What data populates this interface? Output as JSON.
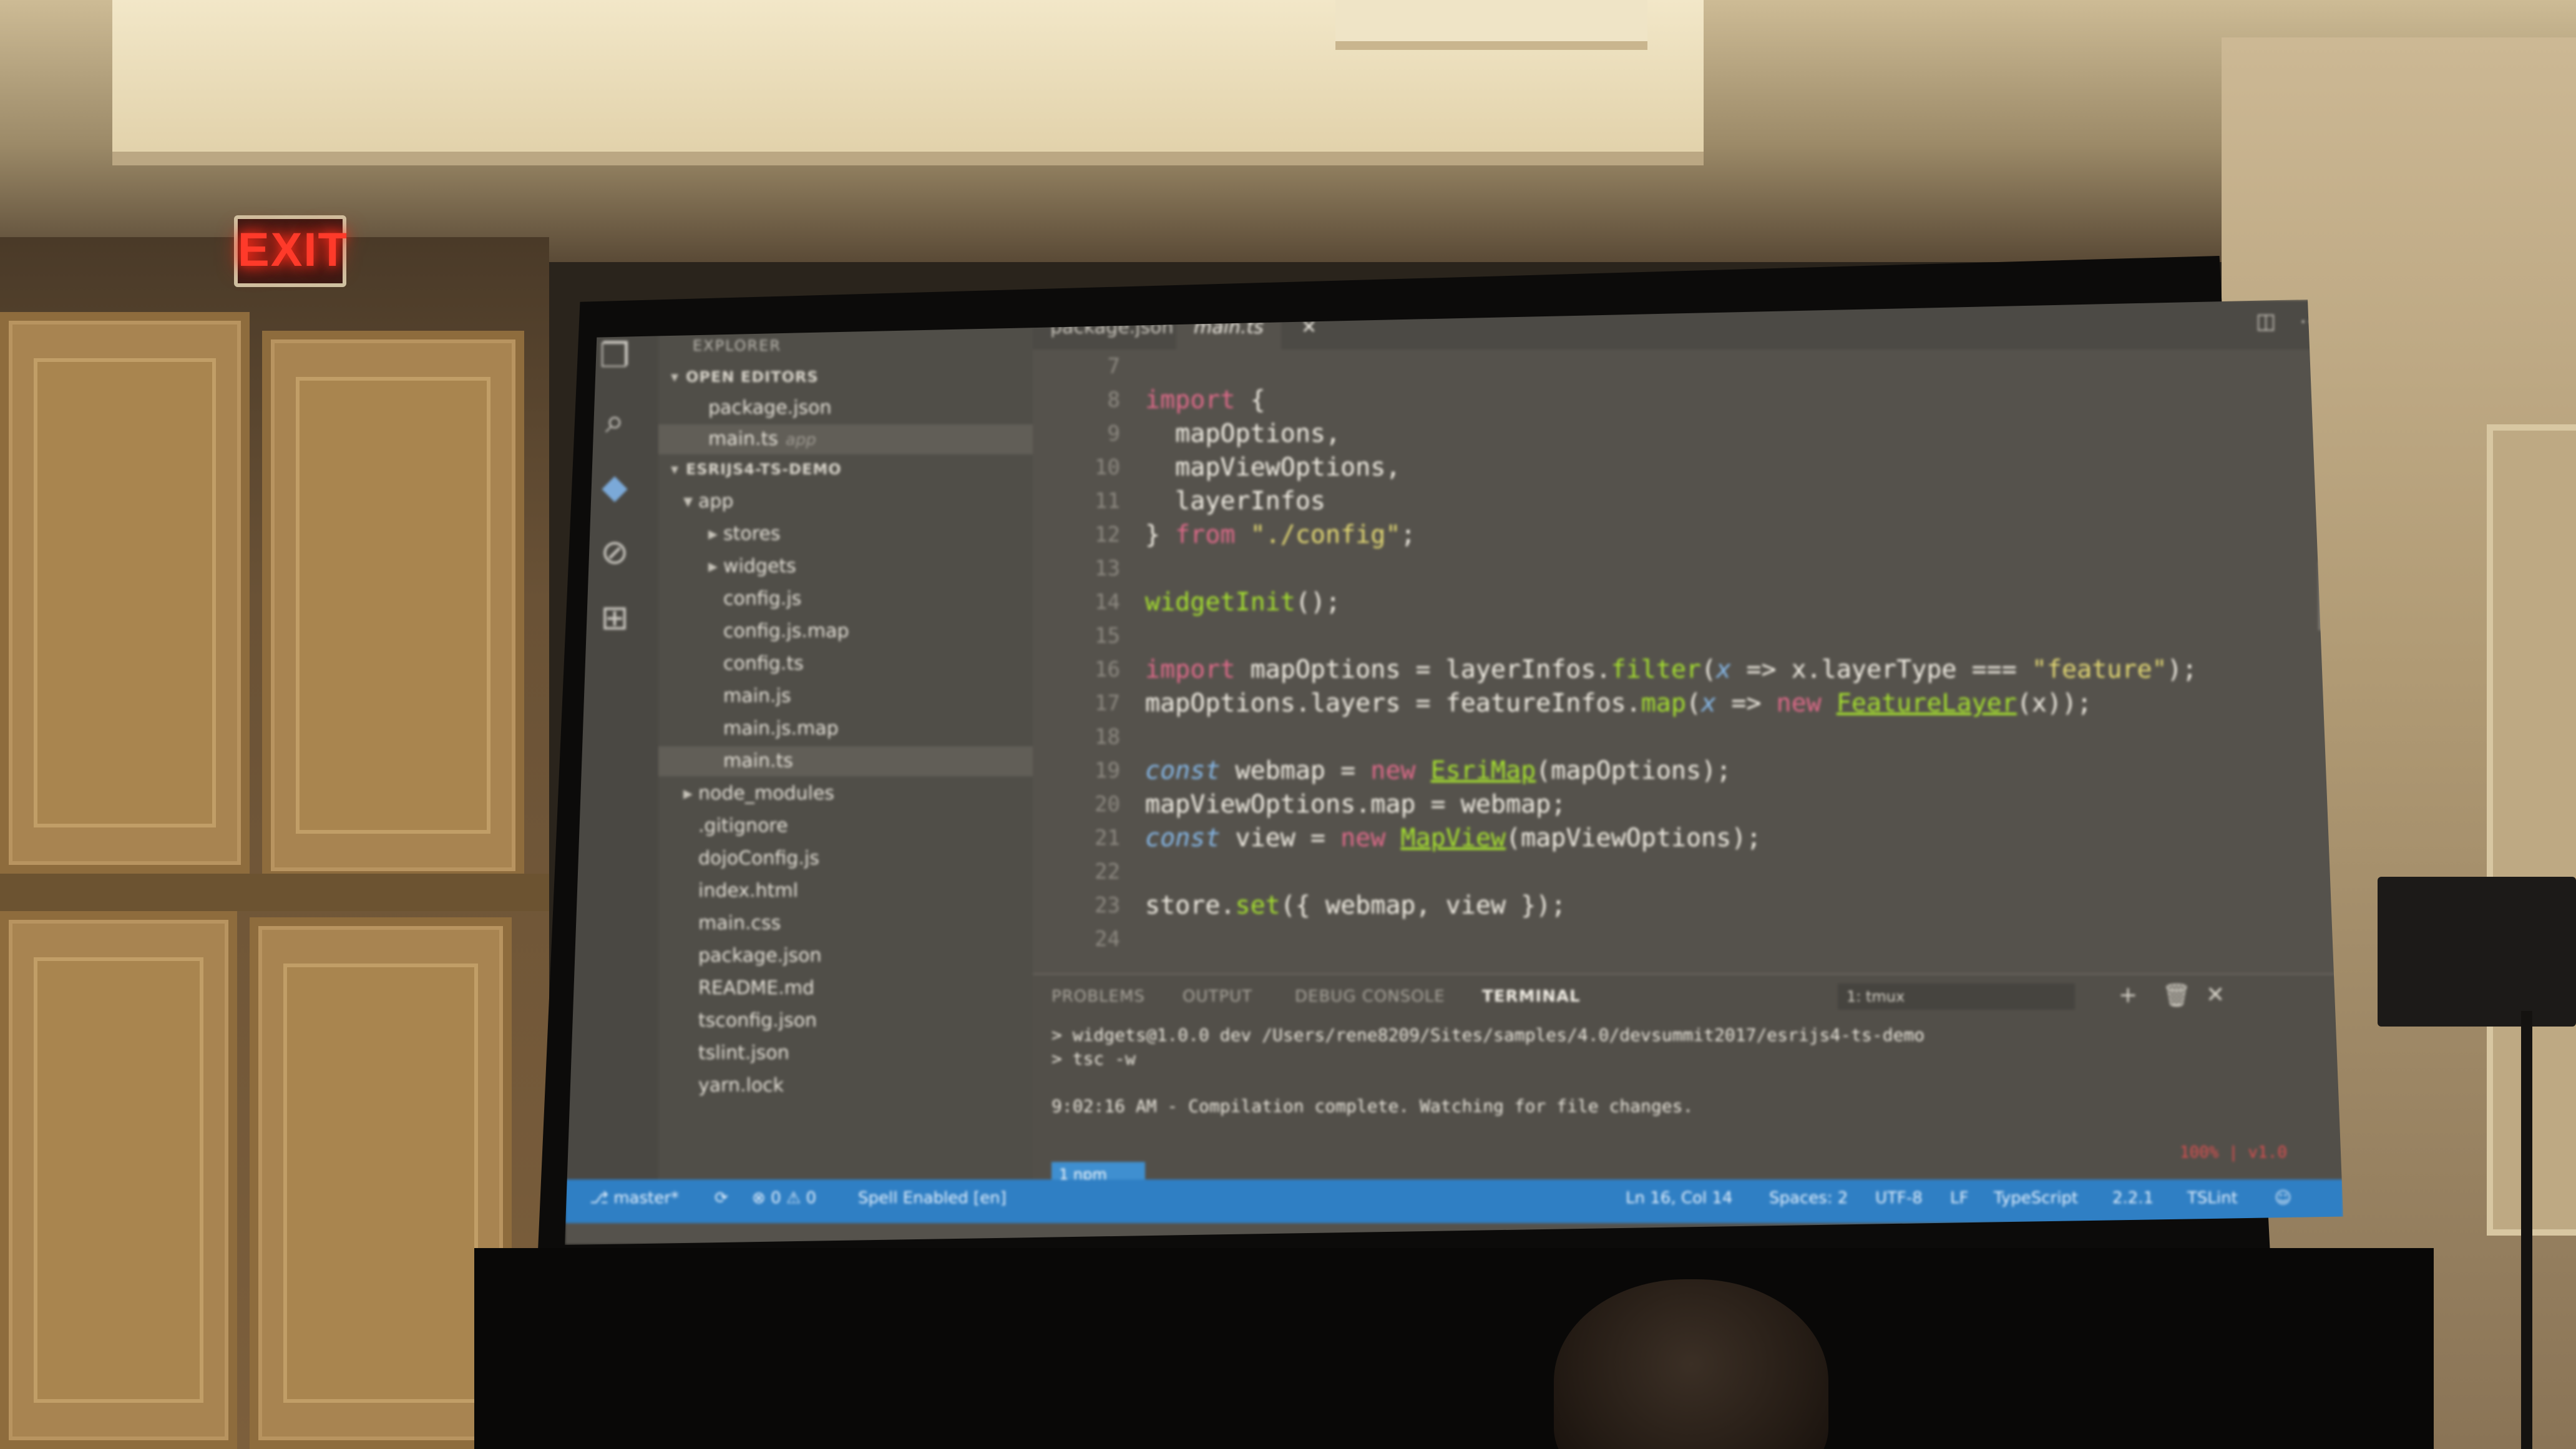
{
  "room": {
    "exit_sign": "EXIT"
  },
  "activity_bar": {
    "icons": [
      "files-icon",
      "search-icon",
      "git-icon",
      "debug-icon",
      "extensions-icon"
    ]
  },
  "explorer": {
    "title": "EXPLORER",
    "open_editors_label": "OPEN EDITORS",
    "open_editors": [
      {
        "name": "package.json",
        "hint": ""
      },
      {
        "name": "main.ts",
        "hint": "app"
      }
    ],
    "project_label": "ESRIJS4-TS-DEMO",
    "tree": [
      {
        "name": "app",
        "twisty": "▾",
        "depth": 1
      },
      {
        "name": "stores",
        "twisty": "▸",
        "depth": 2
      },
      {
        "name": "widgets",
        "twisty": "▸",
        "depth": 2
      },
      {
        "name": "config.js",
        "twisty": "",
        "depth": 2
      },
      {
        "name": "config.js.map",
        "twisty": "",
        "depth": 2
      },
      {
        "name": "config.ts",
        "twisty": "",
        "depth": 2
      },
      {
        "name": "main.js",
        "twisty": "",
        "depth": 2
      },
      {
        "name": "main.js.map",
        "twisty": "",
        "depth": 2
      },
      {
        "name": "main.ts",
        "twisty": "",
        "depth": 2
      },
      {
        "name": "node_modules",
        "twisty": "▸",
        "depth": 1
      },
      {
        "name": ".gitignore",
        "twisty": "",
        "depth": 1
      },
      {
        "name": "dojoConfig.js",
        "twisty": "",
        "depth": 1
      },
      {
        "name": "index.html",
        "twisty": "",
        "depth": 1
      },
      {
        "name": "main.css",
        "twisty": "",
        "depth": 1
      },
      {
        "name": "package.json",
        "twisty": "",
        "depth": 1
      },
      {
        "name": "README.md",
        "twisty": "",
        "depth": 1
      },
      {
        "name": "tsconfig.json",
        "twisty": "",
        "depth": 1
      },
      {
        "name": "tslint.json",
        "twisty": "",
        "depth": 1
      },
      {
        "name": "yarn.lock",
        "twisty": "",
        "depth": 1
      }
    ]
  },
  "tabs": [
    {
      "label": "package.json",
      "active": false
    },
    {
      "label": "main.ts",
      "active": true
    }
  ],
  "tab_close": "✕",
  "editor": {
    "lines": [
      {
        "n": "7",
        "code": ""
      },
      {
        "n": "8",
        "code": "<span class='kw'>import</span> {"
      },
      {
        "n": "9",
        "code": "  mapOptions,"
      },
      {
        "n": "10",
        "code": "  mapViewOptions,"
      },
      {
        "n": "11",
        "code": "  layerInfos"
      },
      {
        "n": "12",
        "code": "} <span class='kw'>from</span> <span class='str'>\"./config\"</span>;"
      },
      {
        "n": "13",
        "code": ""
      },
      {
        "n": "14",
        "code": "<span class='fn'>widgetInit</span>();"
      },
      {
        "n": "15",
        "code": ""
      },
      {
        "n": "16",
        "code": "<span class='kw'>import</span> mapOptions = layerInfos.<span class='fn'>filter</span>(<span class='it'>x</span> =&gt; x.layerType === <span class='str'>\"feature\"</span>);"
      },
      {
        "n": "17",
        "code": "mapOptions.layers = featureInfos.<span class='fn'>map</span>(<span class='it'>x</span> =&gt; <span class='kw'>new</span> <span class='cls'>FeatureLayer</span>(x));"
      },
      {
        "n": "18",
        "code": ""
      },
      {
        "n": "19",
        "code": "<span class='it'>const</span> webmap = <span class='kw'>new</span> <span class='cls'>EsriMap</span>(mapOptions);"
      },
      {
        "n": "20",
        "code": "mapViewOptions.map = webmap;"
      },
      {
        "n": "21",
        "code": "<span class='it'>const</span> view = <span class='kw'>new</span> <span class='cls'>MapView</span>(mapViewOptions);"
      },
      {
        "n": "22",
        "code": ""
      },
      {
        "n": "23",
        "code": "store.<span class='fn'>set</span>({ webmap, view });"
      },
      {
        "n": "24",
        "code": ""
      }
    ]
  },
  "panel": {
    "tabs": [
      "PROBLEMS",
      "OUTPUT",
      "DEBUG CONSOLE",
      "TERMINAL"
    ],
    "active_tab": "TERMINAL",
    "terminal_select": "1: tmux",
    "terminal_lines": [
      "> widgets@1.0.0 dev /Users/rene8209/Sites/samples/4.0/devsummit2017/esrijs4-ts-demo",
      "> tsc -w",
      "",
      "9:02:16 AM - Compilation complete. Watching for file changes."
    ],
    "tmux_tab": "1 npm",
    "tmux_status": "100% | v1.0"
  },
  "status_bar": {
    "branch": "master*",
    "sync": "⟳",
    "errors": "0",
    "warnings": "0",
    "spell": "Spell Enabled [en]",
    "position": "Ln 16, Col 14",
    "spaces": "Spaces: 2",
    "encoding": "UTF-8",
    "eol": "LF",
    "language": "TypeScript",
    "version": "2.2.1",
    "linter": "TSLint",
    "feedback": "☺"
  },
  "colors": {
    "status_bar": "#2f7fc4",
    "keyword": "#e06a8a",
    "function": "#a6e22e",
    "string": "#e6db74"
  }
}
